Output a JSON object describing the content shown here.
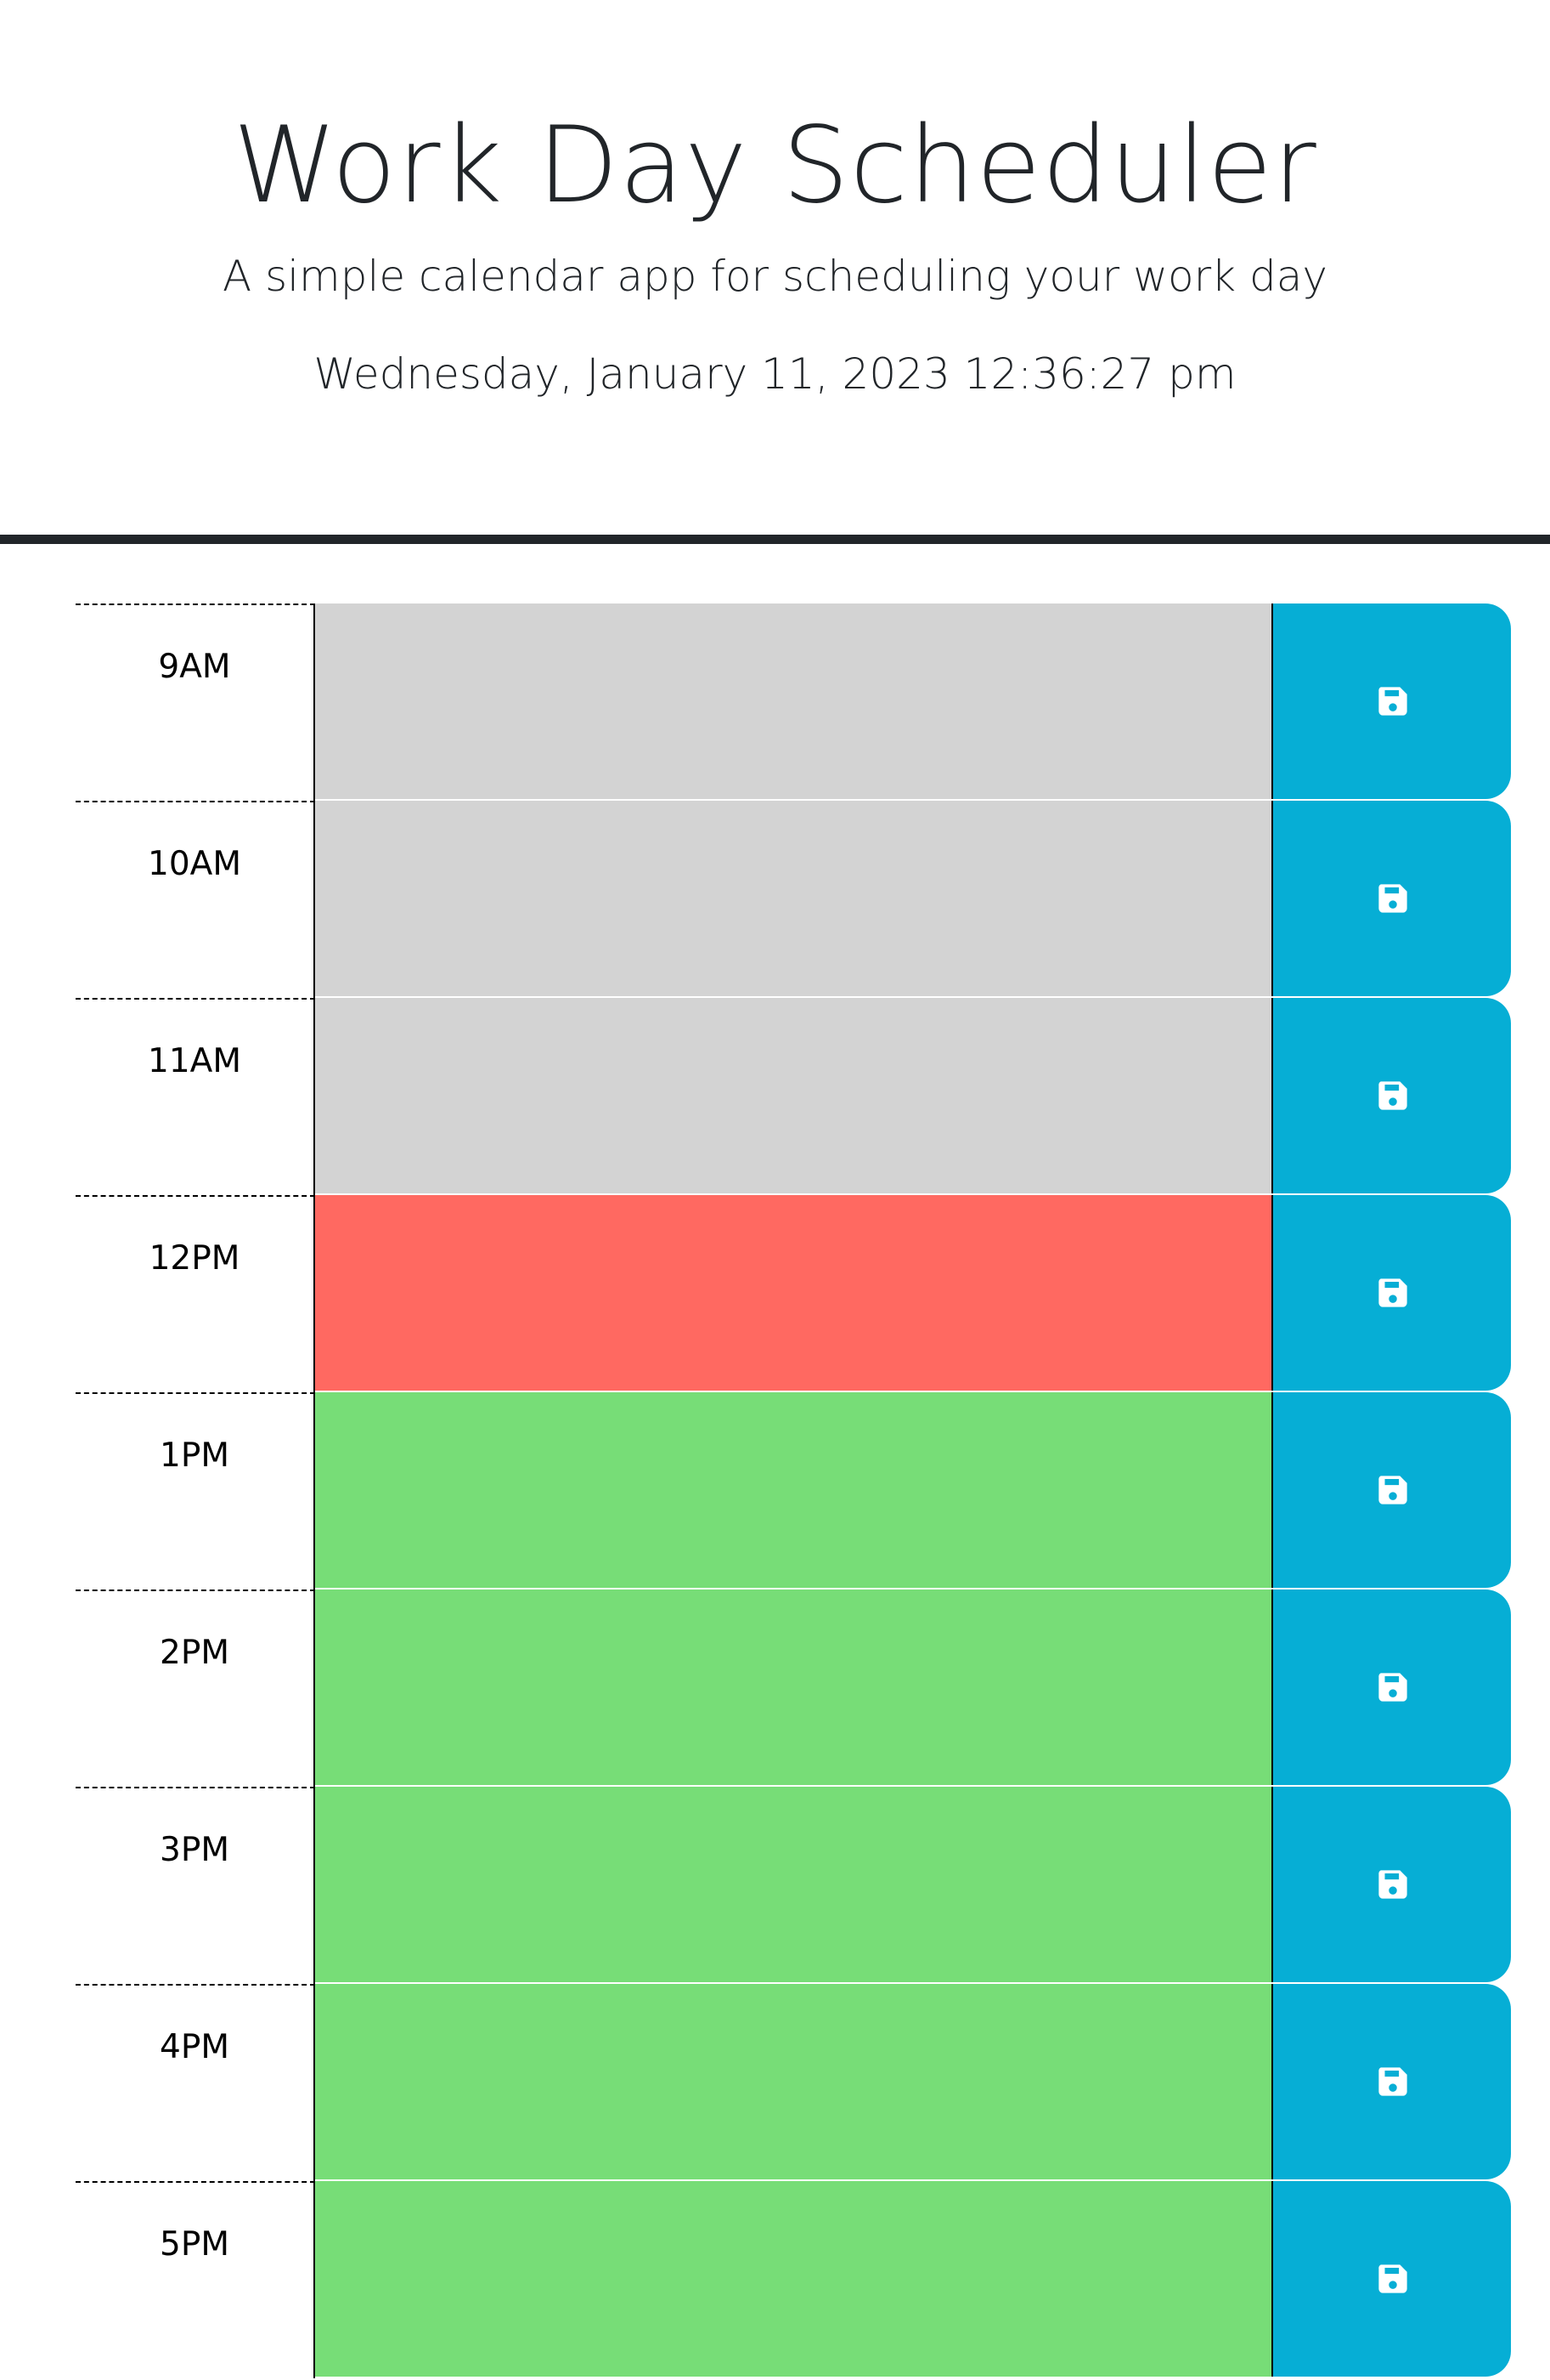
{
  "header": {
    "title": "Work Day Scheduler",
    "subtitle": "A simple calendar app for scheduling your work day",
    "current_datetime": "Wednesday, January 11, 2023 12:36:27 pm"
  },
  "colors": {
    "past": "#d3d3d3",
    "present": "#ff6961",
    "future": "#77dd77",
    "save_button": "#06aed5",
    "icon": "#ffffff"
  },
  "schedule": [
    {
      "hour": "9AM",
      "status": "past",
      "text": ""
    },
    {
      "hour": "10AM",
      "status": "past",
      "text": ""
    },
    {
      "hour": "11AM",
      "status": "past",
      "text": ""
    },
    {
      "hour": "12PM",
      "status": "present",
      "text": ""
    },
    {
      "hour": "1PM",
      "status": "future",
      "text": ""
    },
    {
      "hour": "2PM",
      "status": "future",
      "text": ""
    },
    {
      "hour": "3PM",
      "status": "future",
      "text": ""
    },
    {
      "hour": "4PM",
      "status": "future",
      "text": ""
    },
    {
      "hour": "5PM",
      "status": "future",
      "text": ""
    }
  ],
  "save_icon": "floppy-disk-icon"
}
